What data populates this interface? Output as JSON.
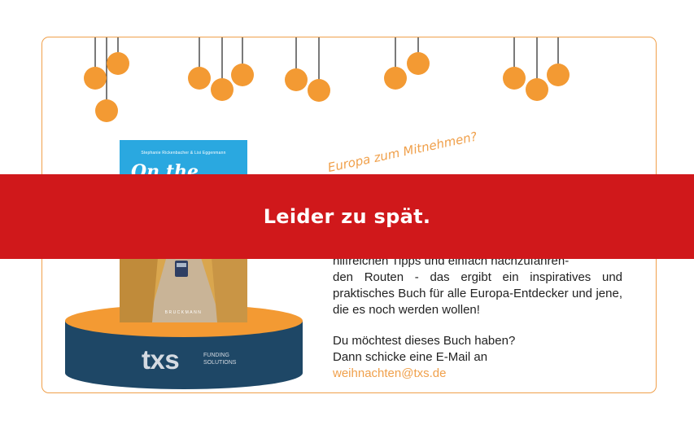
{
  "book": {
    "authors": "Stephanie Rickenbacher & Lisi Eggenmann",
    "title": "On the Road",
    "publisher": "BRUCKMANN"
  },
  "logo": {
    "name": "txs",
    "tagline_line1": "FUNDING",
    "tagline_line2": "SOLUTIONS"
  },
  "headline_handwritten": "Europa zum Mitnehmen?",
  "description": {
    "line1": "hilfreichen Tipps und einfach nachzufahren-",
    "rest": "den Routen - das ergibt ein inspiratives und praktisches Buch für alle Europa-Entdecker und jene, die es noch werden wollen!"
  },
  "cta": {
    "line1": "Du möchtest dieses Buch haben?",
    "line2": "Dann schicke eine E-Mail an",
    "email": "weihnachten@txs.de"
  },
  "banner": {
    "text": "Leider zu spät."
  },
  "colors": {
    "accent_orange": "#f0a04b",
    "banner_red": "#d0181b",
    "podium_navy": "#1e4766",
    "book_blue": "#2aa8e0"
  }
}
